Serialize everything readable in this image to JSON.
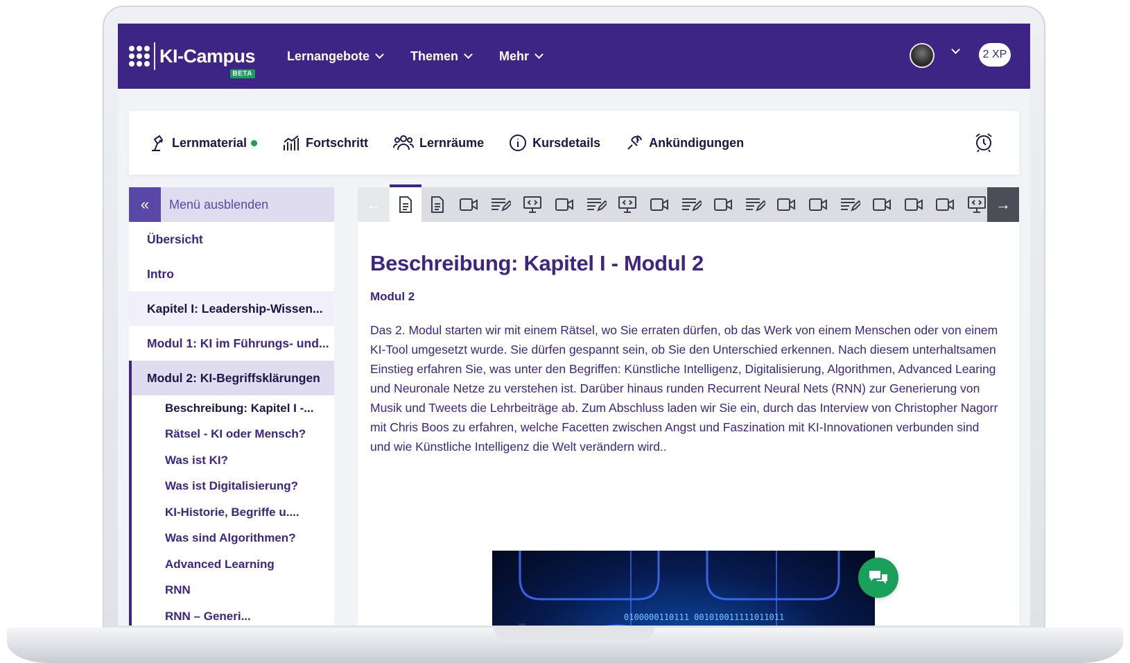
{
  "brand": {
    "name": "KI-Campus",
    "badge": "BETA"
  },
  "header": {
    "nav": [
      {
        "label": "Lernangebote"
      },
      {
        "label": "Themen"
      },
      {
        "label": "Mehr"
      }
    ],
    "xp": "2 XP"
  },
  "course_tabs": [
    {
      "label": "Lernmaterial",
      "icon": "lamp-icon",
      "has_dot": true
    },
    {
      "label": "Fortschritt",
      "icon": "progress-chart-icon"
    },
    {
      "label": "Lernräume",
      "icon": "group-icon"
    },
    {
      "label": "Kursdetails",
      "icon": "info-icon"
    },
    {
      "label": "Ankündigungen",
      "icon": "announcement-icon"
    }
  ],
  "sidebar": {
    "toggle_label": "Menü ausblenden",
    "items": [
      {
        "label": "Übersicht"
      },
      {
        "label": "Intro"
      },
      {
        "label": "Kapitel I: Leadership-Wissen..."
      },
      {
        "label": "Modul 1: KI im Führungs- und..."
      },
      {
        "label": "Modul 2: KI-Begriffsklärungen"
      }
    ],
    "sub_items": [
      {
        "label": "Beschreibung: Kapitel I -..."
      },
      {
        "label": "Rätsel - KI oder Mensch?"
      },
      {
        "label": "Was ist KI?"
      },
      {
        "label": "Was ist Digitalisierung?"
      },
      {
        "label": "KI-Historie, Begriffe u...."
      },
      {
        "label": "Was sind Algorithmen?"
      },
      {
        "label": "Advanced Learning"
      },
      {
        "label": "RNN"
      },
      {
        "label": "RNN – Generi..."
      }
    ]
  },
  "toolbar": {
    "items": [
      "document",
      "document",
      "video",
      "quiz",
      "presentation",
      "video",
      "quiz",
      "presentation",
      "video",
      "quiz",
      "video",
      "quiz",
      "video",
      "video",
      "quiz",
      "video",
      "video",
      "video",
      "presentation"
    ],
    "active_index": 0
  },
  "content": {
    "title": "Beschreibung: Kapitel I - Modul 2",
    "subtitle": "Modul 2",
    "body": "Das 2. Modul starten wir mit einem Rätsel, wo Sie erraten dürfen, ob das Werk von einem Menschen oder von einem KI-Tool umgesetzt wurde. Sie dürfen gespannt sein, ob Sie den Unterschied erkennen. Nach diesem unterhaltsamen Einstieg erfahren Sie, was unter den Begriffen: Künstliche Intelligenz, Digitalisierung, Algorithmen, Advanced Learing und Neuronale Netze zu verstehen ist. Darüber hinaus runden Recurrent Neural Nets (RNN) zur Generierung von Musik und Tweets die Lehrbeiträge ab. Zum Abschluss laden wir Sie ein, durch das Interview von Christopher Nagorr mit Chris Boos zu erfahren, welche Facetten zwischen Angst und Faszination mit KI-Innovationen verbunden sind und wie Künstliche Intelligenz die Welt verändern wird..",
    "image_text": "0100000110111 001010011111011011"
  },
  "colors": {
    "primary": "#3c2585",
    "accent_green": "#19a05a",
    "sidebar_active": "#e0dcef"
  }
}
